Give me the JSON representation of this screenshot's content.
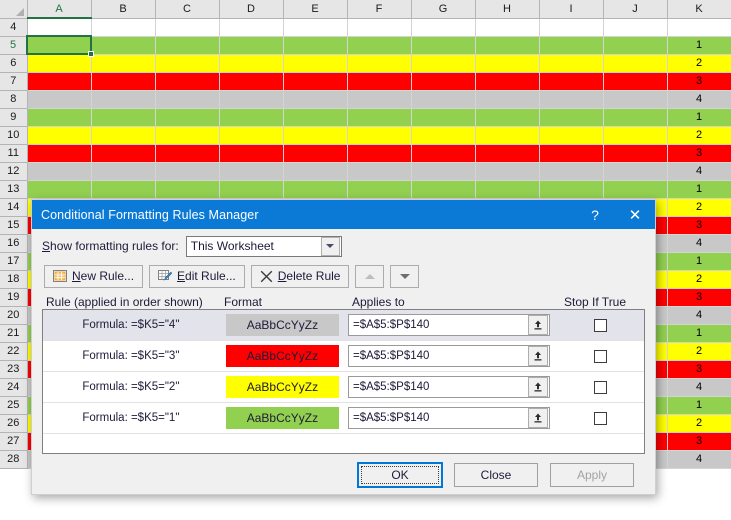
{
  "spreadsheet": {
    "columns": [
      "A",
      "B",
      "C",
      "D",
      "E",
      "F",
      "G",
      "H",
      "I",
      "J",
      "K"
    ],
    "selected_cell": "A5",
    "rows": [
      {
        "num": "4",
        "color": "white",
        "k": ""
      },
      {
        "num": "5",
        "color": "green",
        "k": "1"
      },
      {
        "num": "6",
        "color": "yellow",
        "k": "2"
      },
      {
        "num": "7",
        "color": "red",
        "k": "3"
      },
      {
        "num": "8",
        "color": "gray",
        "k": "4"
      },
      {
        "num": "9",
        "color": "green",
        "k": "1"
      },
      {
        "num": "10",
        "color": "yellow",
        "k": "2"
      },
      {
        "num": "11",
        "color": "red",
        "k": "3"
      },
      {
        "num": "12",
        "color": "gray",
        "k": "4"
      },
      {
        "num": "13",
        "color": "green",
        "k": "1"
      },
      {
        "num": "14",
        "color": "yellow",
        "k": "2"
      },
      {
        "num": "15",
        "color": "red",
        "k": "3"
      },
      {
        "num": "16",
        "color": "gray",
        "k": "4"
      },
      {
        "num": "17",
        "color": "green",
        "k": "1"
      },
      {
        "num": "18",
        "color": "yellow",
        "k": "2"
      },
      {
        "num": "19",
        "color": "red",
        "k": "3"
      },
      {
        "num": "20",
        "color": "gray",
        "k": "4"
      },
      {
        "num": "21",
        "color": "green",
        "k": "1"
      },
      {
        "num": "22",
        "color": "yellow",
        "k": "2"
      },
      {
        "num": "23",
        "color": "red",
        "k": "3"
      },
      {
        "num": "24",
        "color": "gray",
        "k": "4"
      },
      {
        "num": "25",
        "color": "green",
        "k": "1"
      },
      {
        "num": "26",
        "color": "yellow",
        "k": "2"
      },
      {
        "num": "27",
        "color": "red",
        "k": "3"
      },
      {
        "num": "28",
        "color": "gray",
        "k": "4"
      }
    ]
  },
  "dialog": {
    "title": "Conditional Formatting Rules Manager",
    "help_icon": "?",
    "close_icon": "✕",
    "show_rules_label": "Show formatting rules for:",
    "scope_value": "This Worksheet",
    "toolbar": {
      "new_rule": "New Rule...",
      "edit_rule": "Edit Rule...",
      "delete_rule": "Delete Rule",
      "move_up_icon": "move-up-arrow",
      "move_down_icon": "move-down-arrow"
    },
    "columns": {
      "rule": "Rule (applied in order shown)",
      "format": "Format",
      "applies_to": "Applies to",
      "stop_if_true": "Stop If True"
    },
    "rules": [
      {
        "rule": "Formula: =$K5=\"4\"",
        "preview_text": "AaBbCcYyZz",
        "fill": "#c8c8c8",
        "text_color": "#1f1a38",
        "applies_to": "=$A$5:$P$140",
        "stop_if_true": false,
        "selected": true
      },
      {
        "rule": "Formula: =$K5=\"3\"",
        "preview_text": "AaBbCcYyZz",
        "fill": "#ff0000",
        "text_color": "#1f1a38",
        "applies_to": "=$A$5:$P$140",
        "stop_if_true": false,
        "selected": false
      },
      {
        "rule": "Formula: =$K5=\"2\"",
        "preview_text": "AaBbCcYyZz",
        "fill": "#ffff00",
        "text_color": "#1f1a38",
        "applies_to": "=$A$5:$P$140",
        "stop_if_true": false,
        "selected": false
      },
      {
        "rule": "Formula: =$K5=\"1\"",
        "preview_text": "AaBbCcYyZz",
        "fill": "#92d050",
        "text_color": "#1f1a38",
        "applies_to": "=$A$5:$P$140",
        "stop_if_true": false,
        "selected": false
      }
    ],
    "footer": {
      "ok": "OK",
      "close": "Close",
      "apply": "Apply"
    }
  },
  "colors": {
    "titlebar": "#0b7ad6",
    "green": "#92d050",
    "yellow": "#ffff00",
    "red": "#ff0000",
    "gray": "#c8c8c8",
    "excel_green": "#217346"
  }
}
